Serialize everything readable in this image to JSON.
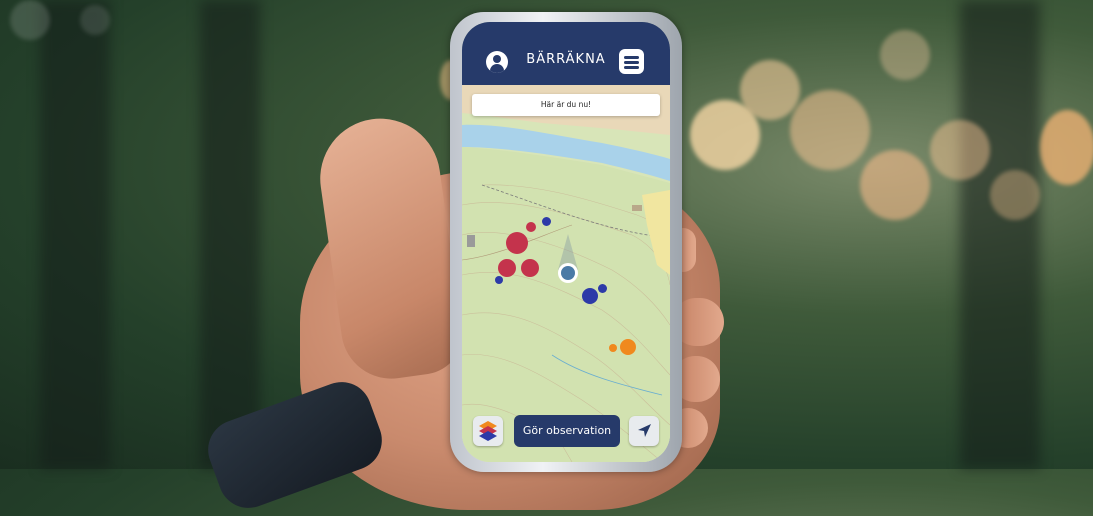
{
  "app": {
    "title": "BÄRRÄKNA"
  },
  "map": {
    "location_banner": "Här är du nu!"
  },
  "toolbar": {
    "observe_label": "Gör observation"
  },
  "icons": {
    "profile": "user-icon",
    "menu": "hamburger-menu-icon",
    "layers": "layers-icon",
    "navigate": "location-arrow-icon"
  },
  "colors": {
    "header": "#263a6a",
    "marker_red": "#c4334c",
    "marker_blue": "#2d3aa8",
    "marker_orange": "#f0891e",
    "user_location": "#4a7aa6"
  }
}
